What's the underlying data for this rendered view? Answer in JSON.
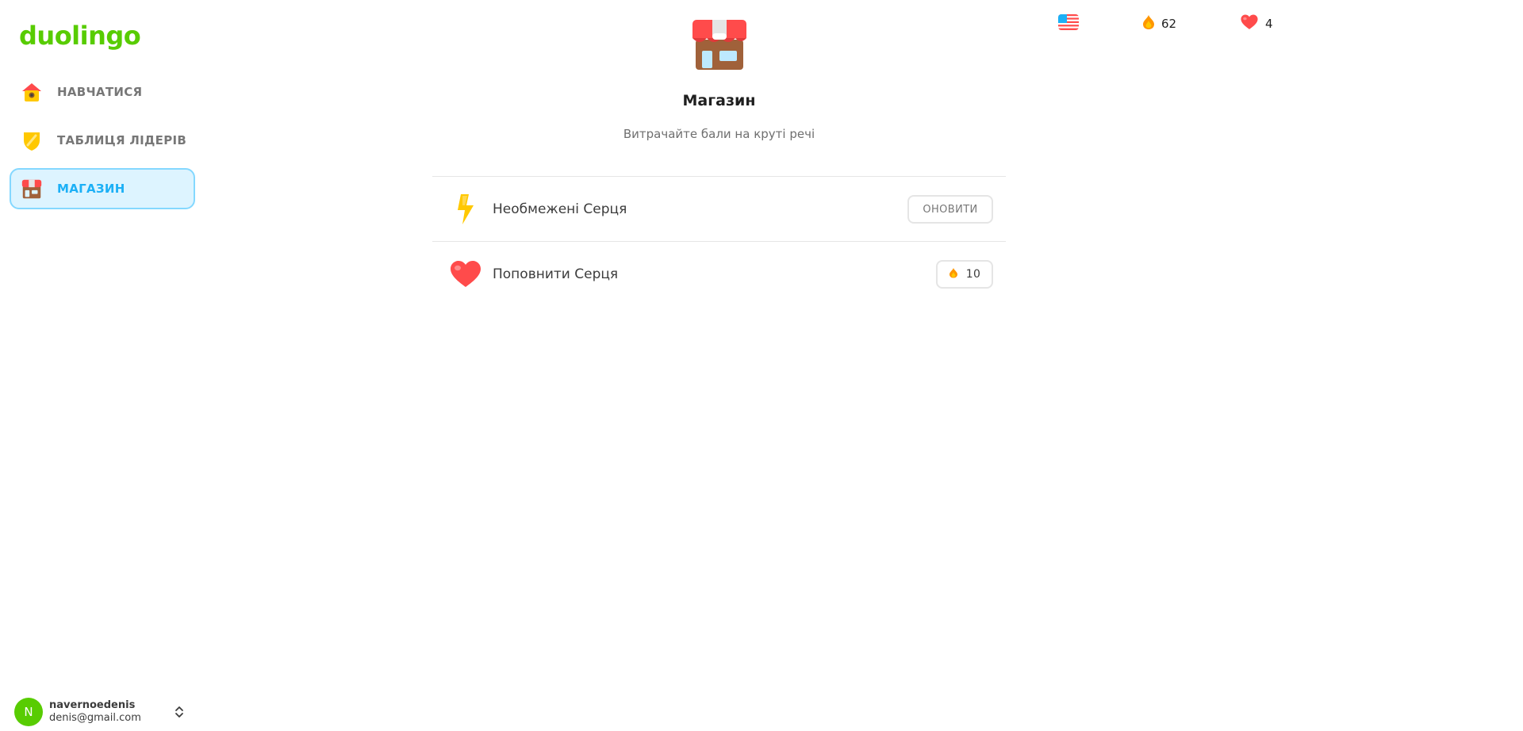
{
  "app": {
    "logo": "duolingo",
    "brand_color": "#58cc02",
    "accent_color": "#1cb0f6"
  },
  "sidebar": {
    "items": [
      {
        "label": "НАВЧАТИСЯ",
        "icon": "home-icon",
        "active": false
      },
      {
        "label": "ТАБЛИЦЯ ЛІДЕРІВ",
        "icon": "leaderboard-shield-icon",
        "active": false
      },
      {
        "label": "МАГАЗИН",
        "icon": "shop-icon",
        "active": true
      }
    ]
  },
  "account": {
    "avatar_initial": "N",
    "username": "navernoedenis",
    "email": "denis@gmail.com"
  },
  "stats": {
    "language_flag": "us-flag-icon",
    "gems": "62",
    "hearts": "4"
  },
  "shop": {
    "title": "Магазин",
    "subtitle": "Витрачайте бали на круті речі",
    "items": [
      {
        "label": "Необмежені Серця",
        "icon": "lightning-icon",
        "button": "ОНОВИТИ"
      },
      {
        "label": "Поповнити Серця",
        "icon": "heart-icon",
        "price": "10"
      }
    ]
  }
}
